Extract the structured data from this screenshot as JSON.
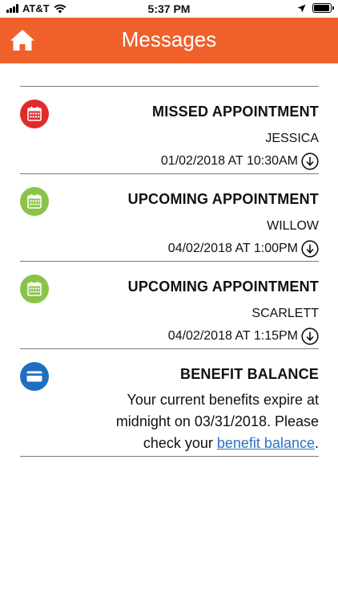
{
  "status_bar": {
    "carrier": "AT&T",
    "time": "5:37 PM",
    "battery_level": 0.95
  },
  "header": {
    "title": "Messages",
    "home_icon": "home-icon"
  },
  "messages": [
    {
      "title": "MISSED APPOINTMENT",
      "name": "JESSICA",
      "datetime": "01/02/2018 AT 10:30AM",
      "icon": "calendar-icon",
      "icon_color": "#e12a2a"
    },
    {
      "title": "UPCOMING APPOINTMENT",
      "name": "WILLOW",
      "datetime": "04/02/2018 AT 1:00PM",
      "icon": "calendar-icon",
      "icon_color": "#8bc34a"
    },
    {
      "title": "UPCOMING APPOINTMENT",
      "name": "SCARLETT",
      "datetime": "04/02/2018 AT 1:15PM",
      "icon": "calendar-icon",
      "icon_color": "#8bc34a"
    }
  ],
  "benefit": {
    "title": "BENEFIT BALANCE",
    "body_before_link": "Your current benefits expire at midnight on 03/31/2018. Please check your ",
    "link_text": "benefit balance",
    "body_after_link": ".",
    "icon": "credit-card-icon",
    "icon_color": "#1f6fc0"
  },
  "colors": {
    "header_bg": "#f0602a",
    "link": "#2a72c6",
    "divider": "#7a7a7a"
  }
}
